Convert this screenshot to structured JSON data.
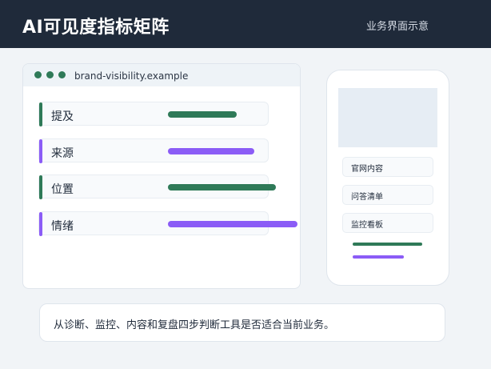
{
  "header": {
    "title": "AI可见度指标矩阵",
    "subtitle": "业务界面示意"
  },
  "browser": {
    "url": "brand-visibility.example",
    "metrics": [
      {
        "label": "提及",
        "color": "#2f7a58",
        "fill": 0.32
      },
      {
        "label": "来源",
        "color": "#8b5cf6",
        "fill": 0.4
      },
      {
        "label": "位置",
        "color": "#2f7a58",
        "fill": 0.5
      },
      {
        "label": "情绪",
        "color": "#8b5cf6",
        "fill": 0.6
      }
    ]
  },
  "phone": {
    "items": [
      "官网内容",
      "问答清单",
      "监控看板"
    ],
    "bars": [
      {
        "color": "#2f7a58",
        "fill": 0.7
      },
      {
        "color": "#8b5cf6",
        "fill": 0.52
      }
    ]
  },
  "note": {
    "text": "从诊断、监控、内容和复盘四步判断工具是否适合当前业务。"
  },
  "colors": {
    "header_bg": "#1f2a3a",
    "accent_green": "#2f7a58",
    "accent_purple": "#8b5cf6"
  }
}
